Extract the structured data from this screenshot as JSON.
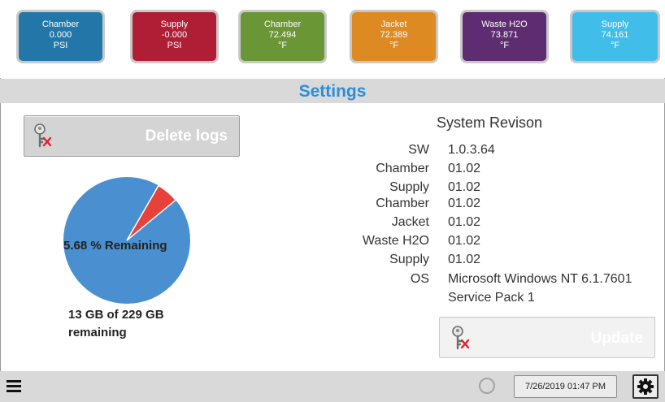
{
  "sensors": [
    {
      "name": "Chamber",
      "value": "0.000",
      "unit": "PSI",
      "color": "#2277a8"
    },
    {
      "name": "Supply",
      "value": "-0.000",
      "unit": "PSI",
      "color": "#b01e36"
    },
    {
      "name": "Chamber",
      "value": "72.494",
      "unit": "°F",
      "color": "#6a9636"
    },
    {
      "name": "Jacket",
      "value": "72.389",
      "unit": "°F",
      "color": "#dd8a22"
    },
    {
      "name": "Waste H2O",
      "value": "73.871",
      "unit": "°F",
      "color": "#5e2c70"
    },
    {
      "name": "Supply",
      "value": "74.161",
      "unit": "°F",
      "color": "#40bde8"
    }
  ],
  "header": {
    "title": "Settings",
    "accent": "#2b8fd8"
  },
  "logs": {
    "delete_label": "Delete logs",
    "remaining_percent": 5.68,
    "pie_label": "5.68 % Remaining",
    "storage_line1": "13 GB of 229 GB",
    "storage_line2": "remaining",
    "used_color": "#4a8fd0",
    "free_color": "#e8413a"
  },
  "revision": {
    "title": "System Revison",
    "rows": [
      {
        "key": "SW",
        "value": "1.0.3.64"
      },
      {
        "key": "Chamber",
        "value": "01.02"
      },
      {
        "key": "Supply",
        "value": "01.02"
      },
      {
        "key": "Chamber",
        "value": "01.02"
      },
      {
        "key": "Jacket",
        "value": "01.02"
      },
      {
        "key": "Waste H2O",
        "value": "01.02"
      },
      {
        "key": "Supply",
        "value": "01.02"
      },
      {
        "key": "OS",
        "value": "Microsoft Windows NT 6.1.7601"
      },
      {
        "key": "",
        "value": "Service Pack 1"
      }
    ],
    "update_label": "Update"
  },
  "footer": {
    "datetime": "7/26/2019 01:47 PM"
  }
}
